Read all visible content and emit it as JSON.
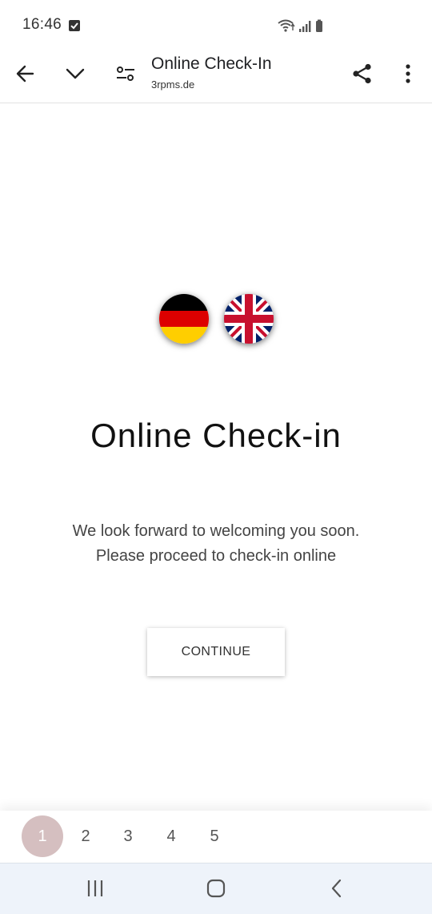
{
  "status_bar": {
    "time": "16:46",
    "notification_icon": "checkbox-notification-icon",
    "icons": [
      "wifi-icon",
      "signal-icon",
      "battery-icon"
    ]
  },
  "toolbar": {
    "title": "Online Check-In",
    "url": "3rpms.de",
    "icons": [
      "back-arrow-icon",
      "chevron-down-icon",
      "site-settings-icon",
      "share-icon",
      "more-vert-icon"
    ]
  },
  "languages": [
    {
      "code": "de",
      "icon": "german-flag-icon"
    },
    {
      "code": "en",
      "icon": "uk-flag-icon"
    }
  ],
  "main": {
    "heading": "Online Check-in",
    "message_line1": "We look forward to welcoming you soon.",
    "message_line2": "Please proceed to check-in online",
    "continue_label": "CONTINUE"
  },
  "stepper": {
    "steps": [
      "1",
      "2",
      "3",
      "4",
      "5"
    ],
    "active_step": "1",
    "active_color": "#d5bfc0"
  },
  "navbar": {
    "icons": [
      "recent-apps-icon",
      "home-icon",
      "back-icon"
    ]
  }
}
